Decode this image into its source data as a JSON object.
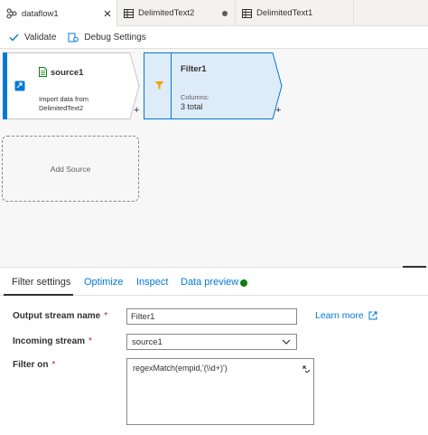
{
  "tabs": [
    {
      "label": "dataflow1",
      "icon": "dataflow-icon",
      "action": "close",
      "active": true
    },
    {
      "label": "DelimitedText2",
      "icon": "table-icon",
      "action": "unsaved-dot",
      "active": false
    },
    {
      "label": "DelimitedText1",
      "icon": "table-icon",
      "action": "none",
      "active": false
    }
  ],
  "toolbar": {
    "validate_label": "Validate",
    "debug_label": "Debug Settings"
  },
  "canvas": {
    "source_node": {
      "title": "source1",
      "description_line1": "Import data from",
      "description_line2": "DelimitedText2"
    },
    "filter_node": {
      "title": "Filter1",
      "columns_label": "Columns:",
      "columns_value": "3 total"
    },
    "plus_glyph": "+",
    "add_source_label": "Add Source"
  },
  "settings_tabs": [
    {
      "label": "Filter settings",
      "active": true
    },
    {
      "label": "Optimize",
      "active": false
    },
    {
      "label": "Inspect",
      "active": false
    },
    {
      "label": "Data preview",
      "active": false
    }
  ],
  "form": {
    "output_stream_label": "Output stream name",
    "output_stream_value": "Filter1",
    "incoming_stream_label": "Incoming stream",
    "incoming_stream_value": "source1",
    "filter_on_label": "Filter on",
    "filter_on_value": "regexMatch(empid,'(\\\\d+)')",
    "required_marker": "*",
    "learn_more_label": "Learn more"
  },
  "colors": {
    "accent": "#0078d4",
    "selected_fill": "#deecf9",
    "status_green": "#107c10",
    "filter_icon": "#f2a500"
  }
}
